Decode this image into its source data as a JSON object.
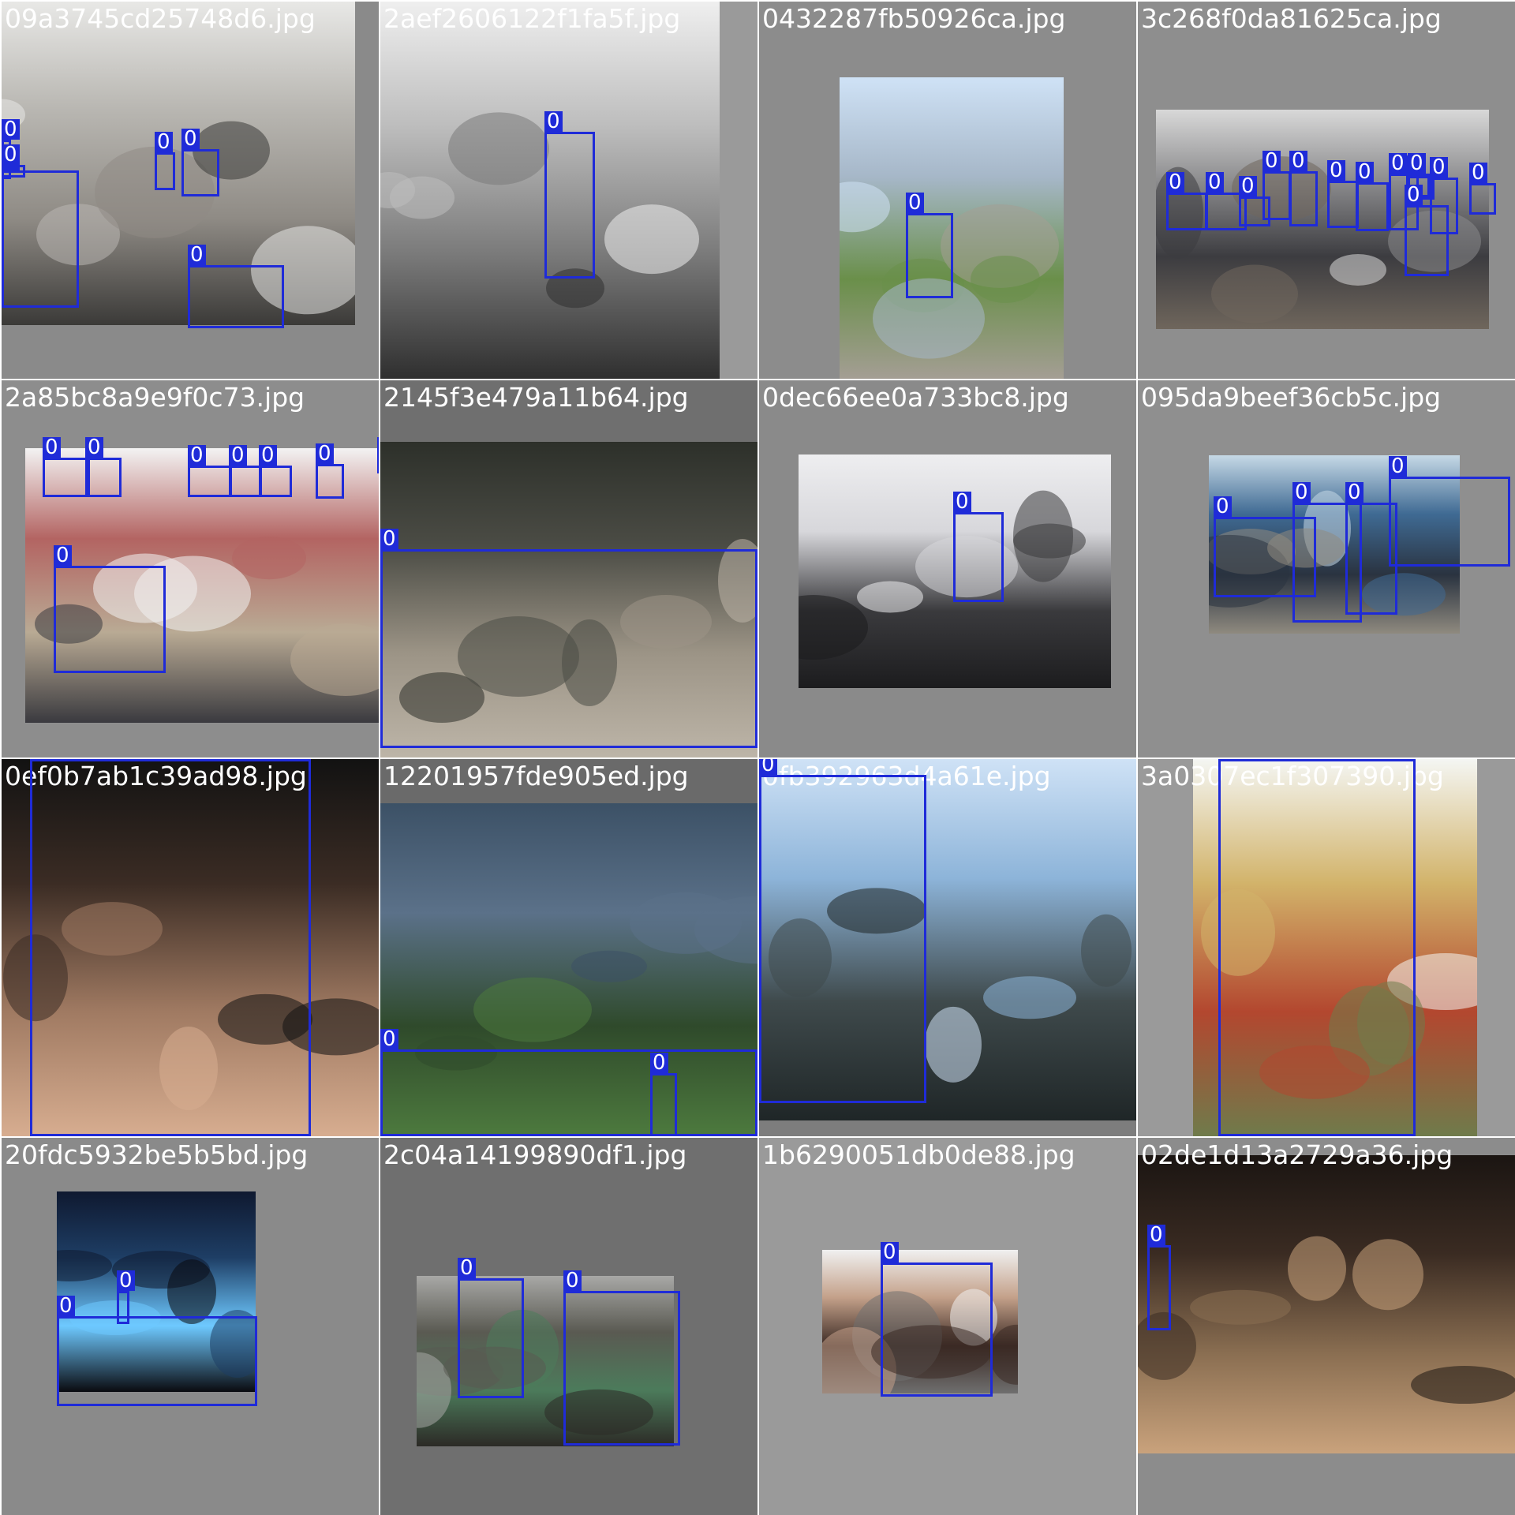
{
  "colors": {
    "box_stroke": "#1f2bd8",
    "label_bg": "#1f2bd8",
    "label_text": "#ffffff",
    "filename_text": "#ffffff"
  },
  "tiles": [
    {
      "filename": "09a3745cd25748d6.jpg",
      "bg": "#8a8a8a",
      "photo_colors": [
        "#e8e8e6",
        "#b9b7b2",
        "#8f8b85",
        "#3b3a38"
      ],
      "boxes": [
        {
          "label": "0"
        },
        {
          "label": "0"
        },
        {
          "label": "0"
        },
        {
          "label": "0"
        },
        {
          "label": "0"
        },
        {
          "label": "0"
        }
      ]
    },
    {
      "filename": "2aef2606122f1fa5f.jpg",
      "bg": "#9a9a9a",
      "photo_colors": [
        "#efefef",
        "#bdbdbd",
        "#7a7a7a",
        "#2f2f2f"
      ],
      "boxes": [
        {
          "label": "0"
        }
      ]
    },
    {
      "filename": "0432287fb50926ca.jpg",
      "bg": "#8c8c8c",
      "photo_colors": [
        "#cfe2f6",
        "#a6b7c8",
        "#6a8f4a",
        "#a49e94"
      ],
      "boxes": [
        {
          "label": "0"
        }
      ]
    },
    {
      "filename": "3c268f0da81625ca.jpg",
      "bg": "#8e8e8e",
      "photo_colors": [
        "#d8d8d8",
        "#8b8b8d",
        "#3c3c40",
        "#6f665c"
      ],
      "boxes": [
        {
          "label": "0"
        },
        {
          "label": "0"
        },
        {
          "label": "0"
        },
        {
          "label": "0"
        },
        {
          "label": "0"
        },
        {
          "label": "0"
        },
        {
          "label": "0"
        },
        {
          "label": "0"
        },
        {
          "label": "0"
        },
        {
          "label": "0"
        },
        {
          "label": "0"
        },
        {
          "label": "0"
        },
        {
          "label": "0"
        }
      ]
    },
    {
      "filename": "2a85bc8a9e9f0c73.jpg",
      "bg": "#8d8d8d",
      "photo_colors": [
        "#f3f3f3",
        "#b36462",
        "#b9aa94",
        "#3a3a3f"
      ],
      "boxes": [
        {
          "label": "0"
        },
        {
          "label": "0"
        },
        {
          "label": "0"
        },
        {
          "label": "0"
        },
        {
          "label": "0"
        },
        {
          "label": "0"
        },
        {
          "label": "0"
        },
        {
          "label": "0"
        }
      ]
    },
    {
      "filename": "2145f3e479a11b64.jpg",
      "bg": "#6f6f6f",
      "photo_colors": [
        "#2d302a",
        "#4b4c45",
        "#9c9486",
        "#bdb5a8"
      ],
      "boxes": [
        {
          "label": "0"
        }
      ]
    },
    {
      "filename": "0dec66ee0a733bc8.jpg",
      "bg": "#8a8a8a",
      "photo_colors": [
        "#eeeef0",
        "#d7d7db",
        "#3a3a3d",
        "#1c1c1e"
      ],
      "boxes": [
        {
          "label": "0"
        }
      ]
    },
    {
      "filename": "095da9beef36cb5c.jpg",
      "bg": "#8f8f8f",
      "photo_colors": [
        "#c6d9e6",
        "#3f6a93",
        "#2a3340",
        "#8f8a7f"
      ],
      "boxes": [
        {
          "label": "0"
        },
        {
          "label": "0"
        },
        {
          "label": "0"
        },
        {
          "label": "0"
        }
      ]
    },
    {
      "filename": "0ef0b7ab1c39ad98.jpg",
      "bg": "#4a4a4a",
      "photo_colors": [
        "#121212",
        "#3b2c24",
        "#a07a62",
        "#d7ad90"
      ],
      "boxes": [
        {
          "label": "0"
        }
      ]
    },
    {
      "filename": "12201957fde905ed.jpg",
      "bg": "#6a6a6a",
      "photo_colors": [
        "#3c5166",
        "#5b7189",
        "#2f4a2b",
        "#4d7a3e"
      ],
      "boxes": [
        {
          "label": "0"
        },
        {
          "label": "0"
        }
      ]
    },
    {
      "filename": "0fb392963d4a61e.jpg",
      "bg": "#7d7d7d",
      "photo_colors": [
        "#cfe2f6",
        "#8db4d9",
        "#3f4a4c",
        "#1f2627"
      ],
      "boxes": [
        {
          "label": "0"
        }
      ]
    },
    {
      "filename": "3a0307ec1f307390.jpg",
      "bg": "#9a9a9a",
      "photo_colors": [
        "#f4f6f3",
        "#d2b36a",
        "#b3472f",
        "#6f7b4b"
      ],
      "boxes": [
        {
          "label": "0"
        }
      ]
    },
    {
      "filename": "20fdc5932be5b5bd.jpg",
      "bg": "#8a8a8a",
      "photo_colors": [
        "#0f1930",
        "#1e3e65",
        "#6ec9ff",
        "#0a0a0f"
      ],
      "boxes": [
        {
          "label": "0"
        },
        {
          "label": "0"
        }
      ]
    },
    {
      "filename": "2c04a14199890df1.jpg",
      "bg": "#6f6f6f",
      "photo_colors": [
        "#a8a8a6",
        "#5a5a52",
        "#4c7b5b",
        "#2c2a26"
      ],
      "boxes": [
        {
          "label": "0"
        },
        {
          "label": "0"
        }
      ]
    },
    {
      "filename": "1b6290051db0de88.jpg",
      "bg": "#9a9a9a",
      "photo_colors": [
        "#f0f0f0",
        "#c4a18a",
        "#3b2a24",
        "#6f6f6f"
      ],
      "boxes": [
        {
          "label": "0"
        }
      ]
    },
    {
      "filename": "02de1d13a2729a36.jpg",
      "bg": "#8c8c8c",
      "photo_colors": [
        "#1b1512",
        "#3a2b22",
        "#8b6f52",
        "#c9a27c"
      ],
      "boxes": [
        {
          "label": "0"
        }
      ]
    }
  ]
}
